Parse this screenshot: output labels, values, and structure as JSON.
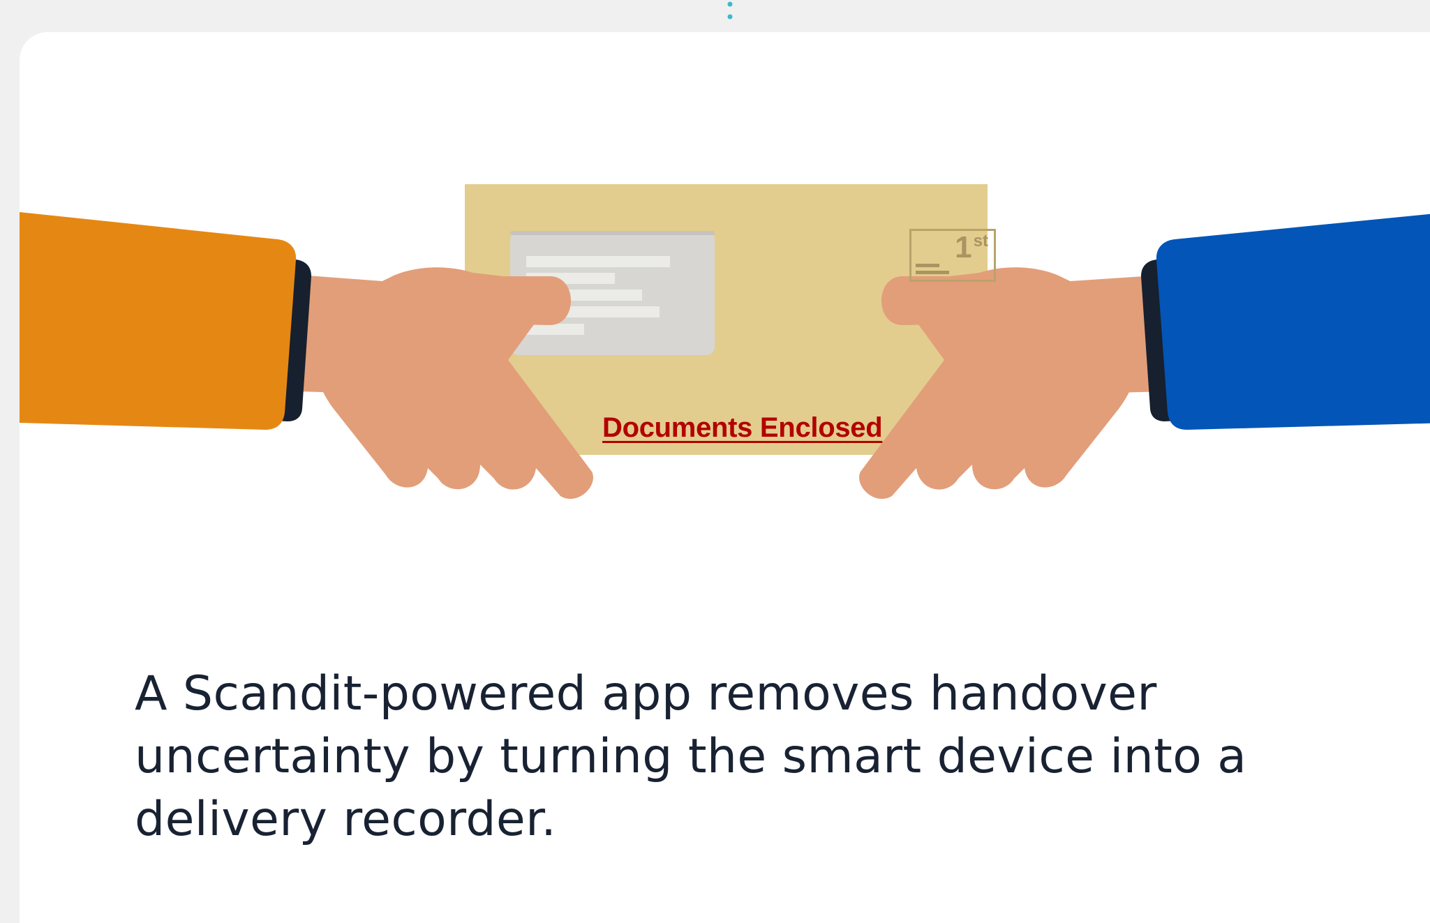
{
  "illustration": {
    "envelope_label": "Documents Enclosed",
    "stamp": {
      "number": "1",
      "suffix": "st"
    }
  },
  "caption": {
    "text": "A Scandit-powered app removes handover uncertainty by turning the smart device into a delivery recorder."
  },
  "colors": {
    "background": "#f0f0f0",
    "card": "#ffffff",
    "left_sleeve": "#e58813",
    "right_sleeve": "#0355b7",
    "cuff": "#17202e",
    "skin": "#e29e79",
    "envelope": "#e2cd8e",
    "envelope_window": "#d8d6d2",
    "label_red": "#b30000",
    "caption_text": "#182233",
    "connector_dots": "#3bb8cc"
  }
}
